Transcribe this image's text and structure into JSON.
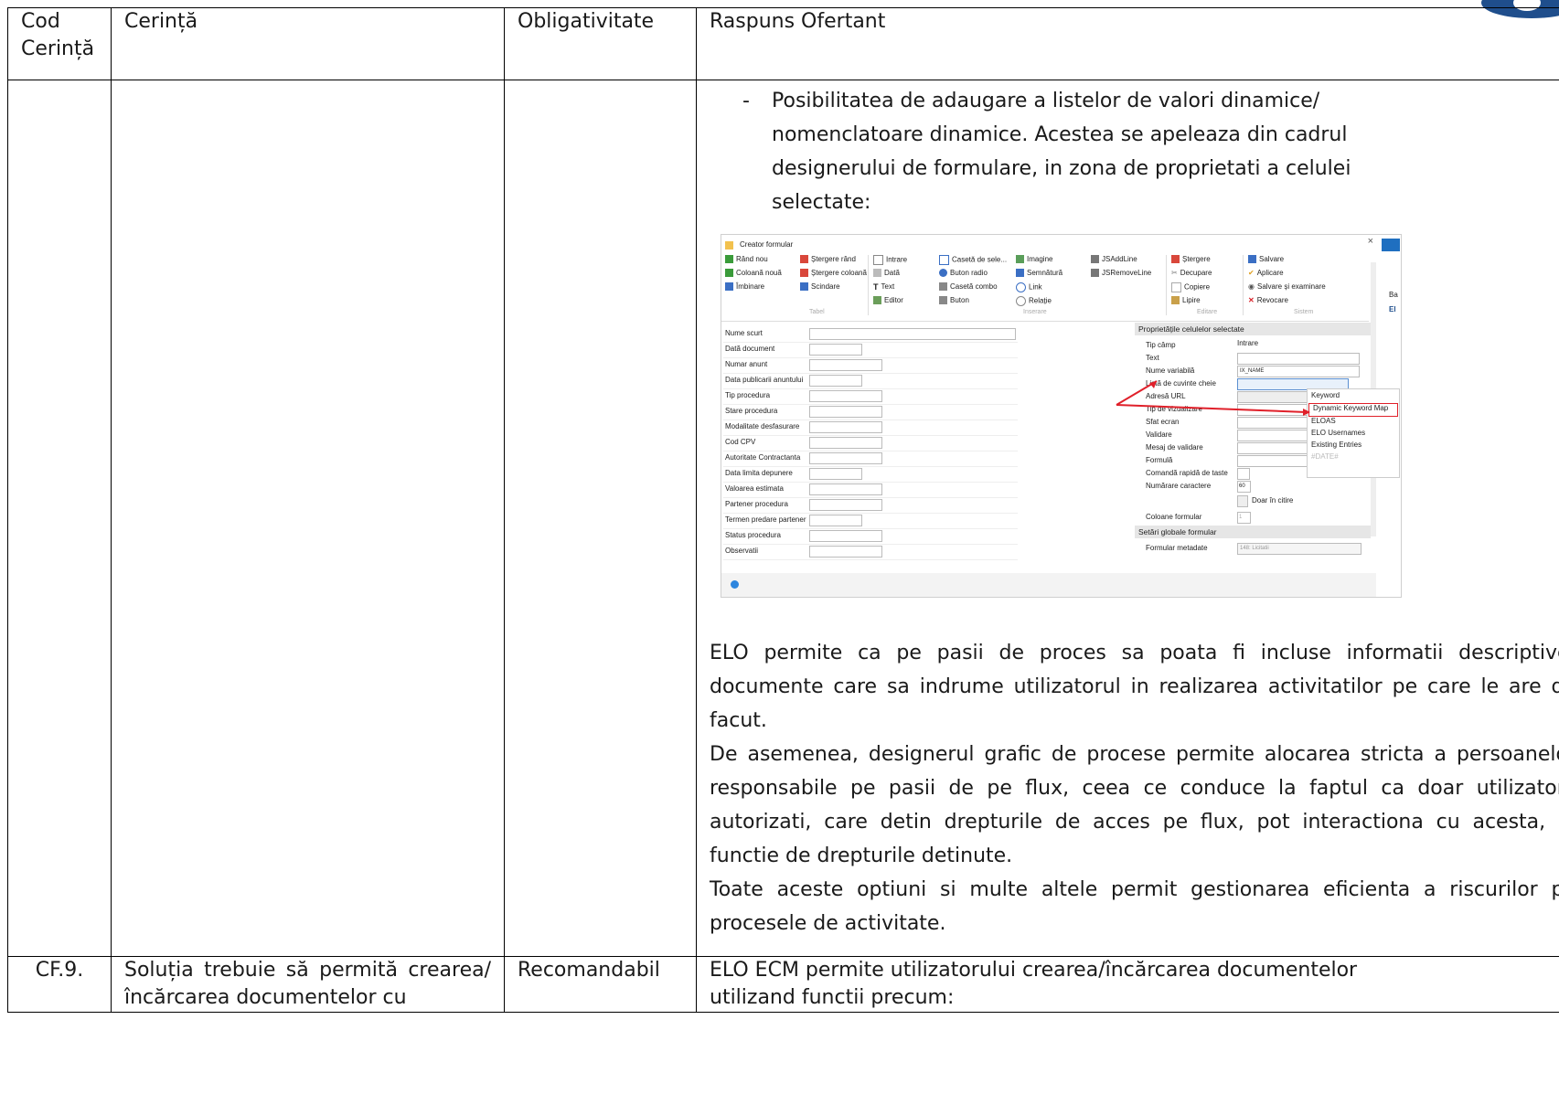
{
  "table": {
    "headers": [
      "Cod Cerință",
      "Cerință",
      "Obligativitate",
      "Raspuns Ofertant"
    ],
    "row1": {
      "bullet": "Posibilitatea de adaugare a listelor de valori dinamice/ nomenclatoare dinamice. Acestea se apeleaza din cadrul designerului de formulare, in zona de proprietati a celulei selectate:",
      "paragraphs": [
        "ELO permite ca pe pasii de proces sa poata fi incluse informatii descriptive/ documente care sa indrume utilizatorul in realizarea activitatilor pe care le are de facut.",
        "De asemenea, designerul grafic de procese permite alocarea stricta a persoanelor responsabile pe pasii de pe flux, ceea ce conduce la faptul ca doar utilizatorii autorizati, care detin drepturile de acces pe flux, pot interactiona cu acesta, in functie de drepturile detinute.",
        "Toate aceste optiuni si multe altele permit gestionarea eficienta a riscurilor pe procesele de activitate."
      ]
    },
    "row2": {
      "code": "CF.9.",
      "requirement": "Soluția trebuie să permită crearea/încărcarea documentelor cu",
      "obligation": "Recomandabil",
      "response": "ELO ECM permite utilizatorului crearea/încărcarea documentelor utilizand functii precum:"
    }
  },
  "screenshot": {
    "title": "Creator formular",
    "groups": {
      "tabel": {
        "label": "Tabel",
        "col1": [
          "Rând nou",
          "Coloană nouă",
          "Îmbinare"
        ],
        "col2": [
          "Ștergere rând",
          "Ștergere coloană",
          "Scindare"
        ]
      },
      "inserare": {
        "label": "Inserare",
        "col1": [
          "Intrare",
          "Dată",
          "Text",
          "Editor"
        ],
        "col2": [
          "Casetă de sele...",
          "Buton radio",
          "Casetă combo",
          "Buton"
        ],
        "col3": [
          "Imagine",
          "Semnătură",
          "Link",
          "Relație"
        ],
        "col4": [
          "JSAddLine",
          "JSRemoveLine"
        ]
      },
      "editare": {
        "label": "Editare",
        "items": [
          "Ștergere",
          "Decupare",
          "Copiere",
          "Lipire"
        ]
      },
      "sistem": {
        "label": "Sistem",
        "items": [
          "Salvare",
          "Aplicare",
          "Salvare și examinare",
          "Revocare"
        ]
      }
    },
    "form_fields": [
      "Nume scurt",
      "Dată document",
      "Numar anunt",
      "Data publicarii anuntului",
      "Tip procedura",
      "Stare procedura",
      "Modalitate desfasurare",
      "Cod CPV",
      "Autoritate Contractanta",
      "Data limita depunere",
      "Valoarea estimata",
      "Partener procedura",
      "Termen predare partener",
      "Status procedura",
      "Observatii"
    ],
    "props_header": "Proprietățile celulelor selectate",
    "props": [
      "Tip câmp",
      "Text",
      "Nume variabilă",
      "Listă de cuvinte cheie",
      "Adresă URL",
      "Tip de vizualizare",
      "Sfat ecran",
      "Validare",
      "Mesaj de validare",
      "Formulă",
      "Comandă rapidă de taste",
      "Numărare caractere"
    ],
    "prop_values": {
      "tip_camp": "Intrare",
      "nume_variabila": "IX_NAME",
      "numarare": "60",
      "doar_citire": "Doar în citire",
      "coloane_formular": "Coloane formular",
      "coloane_val": "1"
    },
    "global_header": "Setări globale formular",
    "formular_metadate": "Formular metadate",
    "formular_metadate_val": "148: Licitatii",
    "dropdown": [
      "Keyword",
      "Dynamic Keyword Map",
      "ELOAS",
      "ELO Usernames",
      "Existing Entries",
      "#DATE#"
    ],
    "side_letters": [
      "Ba",
      "El"
    ]
  },
  "colors": {
    "highlight": "#e0202a",
    "logo": "#1f4e8c"
  }
}
